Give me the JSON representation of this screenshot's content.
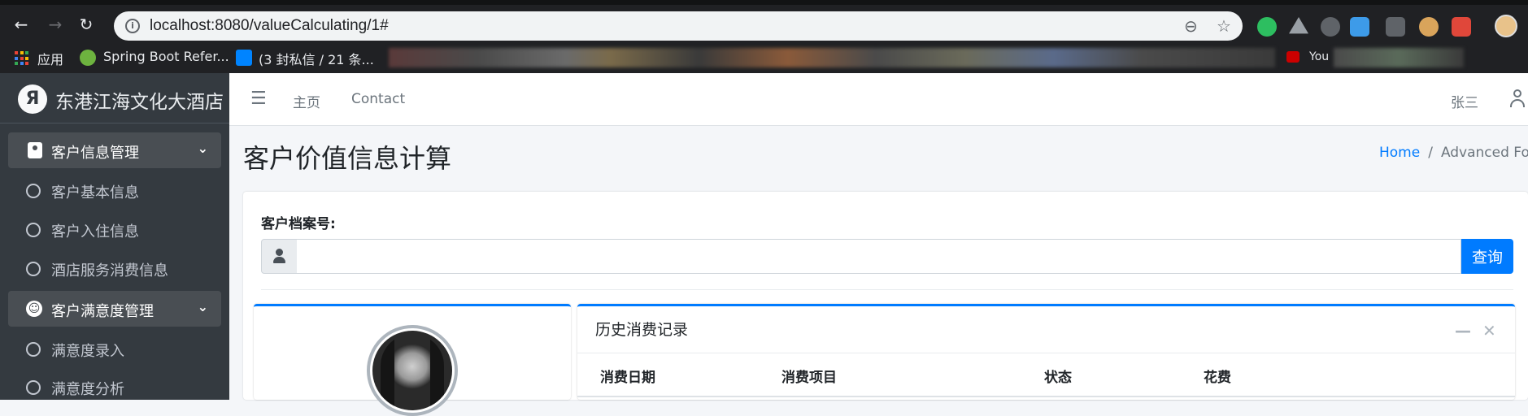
{
  "browser": {
    "url": "localhost:8080/valueCalculating/1#",
    "bookmarks": [
      {
        "label": "应用"
      },
      {
        "label": "Spring Boot Refer..."
      },
      {
        "label": "(3 封私信 / 21 条..."
      },
      {
        "label": "You"
      }
    ]
  },
  "sidebar": {
    "brand": "东港江海文化大酒店",
    "items": [
      {
        "label": "客户信息管理",
        "type": "header",
        "icon": "id-card-icon"
      },
      {
        "label": "客户基本信息",
        "type": "link",
        "icon": "circle-icon"
      },
      {
        "label": "客户入住信息",
        "type": "link",
        "icon": "circle-icon"
      },
      {
        "label": "酒店服务消费信息",
        "type": "link",
        "icon": "circle-icon"
      },
      {
        "label": "客户满意度管理",
        "type": "header",
        "icon": "smile-icon"
      },
      {
        "label": "满意度录入",
        "type": "link",
        "icon": "circle-icon"
      },
      {
        "label": "满意度分析",
        "type": "link",
        "icon": "circle-icon"
      }
    ]
  },
  "navbar": {
    "home": "主页",
    "contact": "Contact",
    "user": "张三"
  },
  "page": {
    "title": "客户价值信息计算",
    "breadcrumb": {
      "home": "Home",
      "separator": "/",
      "current": "Advanced Form"
    }
  },
  "form": {
    "label": "客户档案号:",
    "value": "",
    "button": "查询"
  },
  "history": {
    "title": "历史消费记录",
    "columns": [
      "消费日期",
      "消费项目",
      "状态",
      "花费"
    ]
  },
  "colors": {
    "primary": "#007bff",
    "sidebar_bg": "#343a40",
    "sidebar_active": "#494e53"
  }
}
